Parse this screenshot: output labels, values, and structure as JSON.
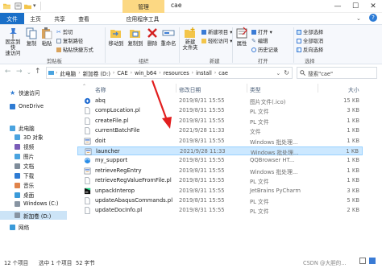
{
  "titlebar": {
    "context_tab": "管理",
    "title": "cae",
    "minimize": "—",
    "maximize": "☐",
    "close": "✕"
  },
  "tabs": [
    "文件",
    "主页",
    "共享",
    "查看",
    "应用程序工具"
  ],
  "ribbon": {
    "pin_label": "固定到快\n速访问",
    "copy_label": "复制",
    "paste_label": "粘贴",
    "cut_label": "剪切",
    "copy_path_label": "复制路径",
    "paste_shortcut_label": "粘贴快捷方式",
    "clipboard_group": "剪贴板",
    "move_to_label": "移动到",
    "copy_to_label": "复制到",
    "delete_label": "删除",
    "rename_label": "重命名",
    "organize_group": "组织",
    "new_folder_label": "新建\n文件夹",
    "new_item_label": "新建项目 ▾",
    "easy_access_label": "轻松访问 ▾",
    "new_group": "新建",
    "properties_label": "属性",
    "open_label": "打开 ▾",
    "edit_label": "编辑",
    "history_label": "历史记录",
    "open_group": "打开",
    "select_all_label": "全部选择",
    "select_none_label": "全部取消",
    "invert_selection_label": "反向选择",
    "select_group": "选择"
  },
  "address": {
    "crumbs": [
      "此电脑",
      "新加卷 (D:)",
      "CAE",
      "win_b64",
      "resources",
      "install",
      "cae"
    ],
    "search_placeholder": "搜索\"cae\""
  },
  "nav": {
    "items": [
      {
        "label": "快速访问",
        "icon": "star-icon"
      },
      {
        "label": "OneDrive",
        "icon": "cloud-icon"
      },
      {
        "label": "此电脑",
        "icon": "computer-icon"
      },
      {
        "label": "3D 对象",
        "icon": "cube-icon"
      },
      {
        "label": "视频",
        "icon": "video-icon"
      },
      {
        "label": "图片",
        "icon": "picture-icon"
      },
      {
        "label": "文档",
        "icon": "document-icon"
      },
      {
        "label": "下载",
        "icon": "download-icon"
      },
      {
        "label": "音乐",
        "icon": "music-icon"
      },
      {
        "label": "桌面",
        "icon": "desktop-icon"
      },
      {
        "label": "Windows (C:)",
        "icon": "drive-icon"
      },
      {
        "label": "新加卷 (D:)",
        "icon": "drive-icon"
      },
      {
        "label": "网络",
        "icon": "network-icon"
      }
    ]
  },
  "list": {
    "headers": {
      "name": "名称",
      "date": "修改日期",
      "type": "类型",
      "size": "大小"
    },
    "rows": [
      {
        "name": "abq",
        "date": "2019/8/31 15:55",
        "type": "图片文件(.ico)",
        "size": "15 KB",
        "icon": "abaqus-icon",
        "selected": false
      },
      {
        "name": "compLocation.pl",
        "date": "2019/8/31 15:55",
        "type": "PL 文件",
        "size": "3 KB",
        "icon": "file-icon",
        "selected": false
      },
      {
        "name": "createFile.pl",
        "date": "2019/8/31 15:55",
        "type": "PL 文件",
        "size": "1 KB",
        "icon": "file-icon",
        "selected": false
      },
      {
        "name": "currentBatchFile",
        "date": "2021/9/28 11:33",
        "type": "文件",
        "size": "1 KB",
        "icon": "file-icon",
        "selected": false
      },
      {
        "name": "doit",
        "date": "2019/8/31 15:55",
        "type": "Windows 批处理...",
        "size": "1 KB",
        "icon": "batch-icon",
        "selected": false
      },
      {
        "name": "launcher",
        "date": "2021/9/28 11:33",
        "type": "Windows 批处理...",
        "size": "1 KB",
        "icon": "batch-icon",
        "selected": true
      },
      {
        "name": "my_support",
        "date": "2019/8/31 15:55",
        "type": "QQBrowser HT...",
        "size": "1 KB",
        "icon": "browser-icon",
        "selected": false
      },
      {
        "name": "retrieveRegEntry",
        "date": "2019/8/31 15:55",
        "type": "Windows 批处理...",
        "size": "1 KB",
        "icon": "batch-icon",
        "selected": false
      },
      {
        "name": "retrieveRegValueFromFile.pl",
        "date": "2019/8/31 15:55",
        "type": "PL 文件",
        "size": "1 KB",
        "icon": "file-icon",
        "selected": false
      },
      {
        "name": "unpackInterop",
        "date": "2019/8/31 15:55",
        "type": "JetBrains PyCharm",
        "size": "3 KB",
        "icon": "pycharm-icon",
        "selected": false
      },
      {
        "name": "updateAbaqusCommands.pl",
        "date": "2019/8/31 15:55",
        "type": "PL 文件",
        "size": "5 KB",
        "icon": "file-icon",
        "selected": false
      },
      {
        "name": "updateDocInfo.pl",
        "date": "2019/8/31 15:55",
        "type": "PL 文件",
        "size": "2 KB",
        "icon": "file-icon",
        "selected": false
      }
    ]
  },
  "status": {
    "count": "12 个项目",
    "selected": "选中 1 个项目",
    "size": "52 字节",
    "watermark": "CSDN @大胆的..."
  },
  "colors": {
    "accent": "#1a6fc8",
    "selection": "#cce8ff",
    "arrow": "#e21e1e"
  }
}
